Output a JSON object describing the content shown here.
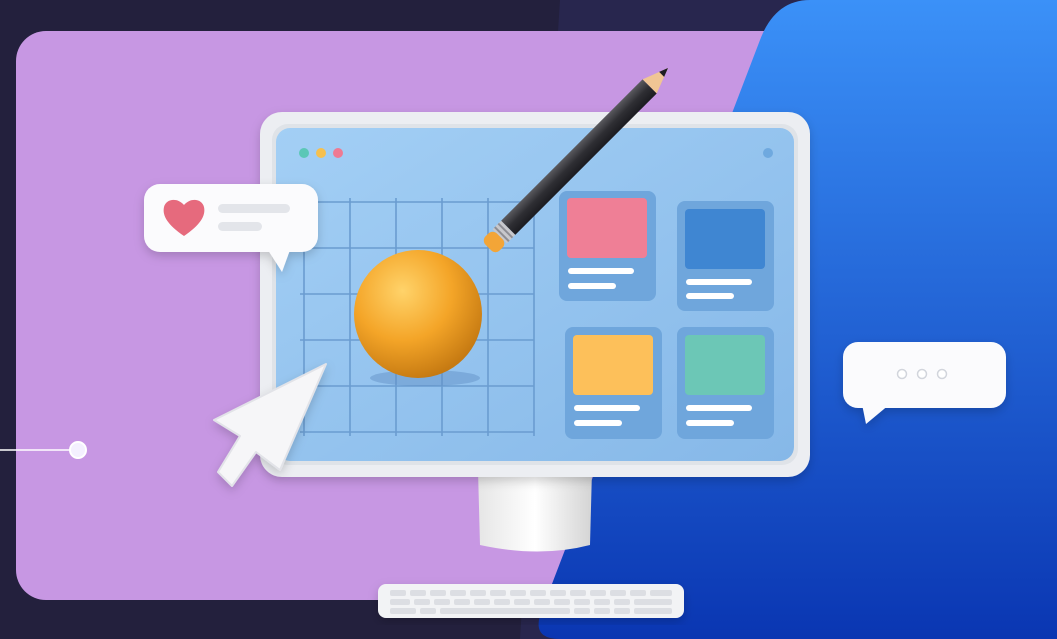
{
  "palette": {
    "background": "#23203d",
    "panel_purple": "#c797e3",
    "panel_blue_top": "#3a8ef6",
    "panel_blue_bottom": "#0b3bb8",
    "screen": "#93c3ee",
    "card_pink": "#ef7f96",
    "card_blue": "#3f86d2",
    "card_yellow": "#fdc05a",
    "card_green": "#6cc7b6",
    "sphere": "#f5a52a",
    "heart": "#e66a7d"
  },
  "scene": {
    "icons": [
      "heart-icon",
      "cursor-icon",
      "pencil-icon",
      "ellipsis-icon",
      "keyboard-icon",
      "monitor-icon"
    ]
  }
}
